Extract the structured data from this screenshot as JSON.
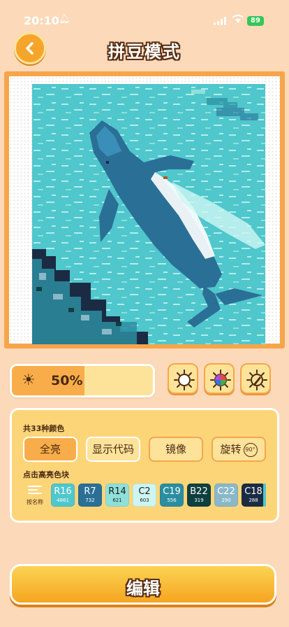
{
  "status_bar": {
    "time": "20:10",
    "battery": "89"
  },
  "header": {
    "title": "拼豆模式",
    "back_icon": "chevron-left-icon"
  },
  "brightness": {
    "value": "50%",
    "level": 0.5
  },
  "tools": [
    "sun-icon",
    "rainbow-palette-icon",
    "pencil-sun-icon"
  ],
  "panel": {
    "color_count_label": "共33种颜色",
    "options": [
      {
        "label": "全亮",
        "state": "active"
      },
      {
        "label": "显示代码",
        "state": "outlined"
      },
      {
        "label": "镜像",
        "state": "normal"
      },
      {
        "label": "旋转",
        "state": "normal",
        "extra": "90°"
      }
    ],
    "hint": "点击高亮色块",
    "sort_label": "按名称",
    "swatches": [
      {
        "code": "R16",
        "count": "4861",
        "color": "#4fc7cc",
        "text": "#ffffff"
      },
      {
        "code": "R7",
        "count": "732",
        "color": "#2a6f96",
        "text": "#ffffff"
      },
      {
        "code": "R14",
        "count": "621",
        "color": "#8fe0d9",
        "text": "#1e1e1e"
      },
      {
        "code": "C2",
        "count": "603",
        "color": "#cdf6f2",
        "text": "#1e1e1e"
      },
      {
        "code": "C19",
        "count": "556",
        "color": "#2b8da0",
        "text": "#ffffff"
      },
      {
        "code": "B22",
        "count": "319",
        "color": "#0f3f3f",
        "text": "#ffffff"
      },
      {
        "code": "C22",
        "count": "290",
        "color": "#8ab8c8",
        "text": "#ffffff"
      },
      {
        "code": "C18",
        "count": "288",
        "color": "#1b2b44",
        "text": "#ffffff"
      }
    ]
  },
  "edit_button": {
    "label": "编辑"
  },
  "colors": {
    "background": "#fcd9b8",
    "accent": "#f6a52b",
    "panel": "#fdd579",
    "ocean": "#4fc7cc"
  }
}
